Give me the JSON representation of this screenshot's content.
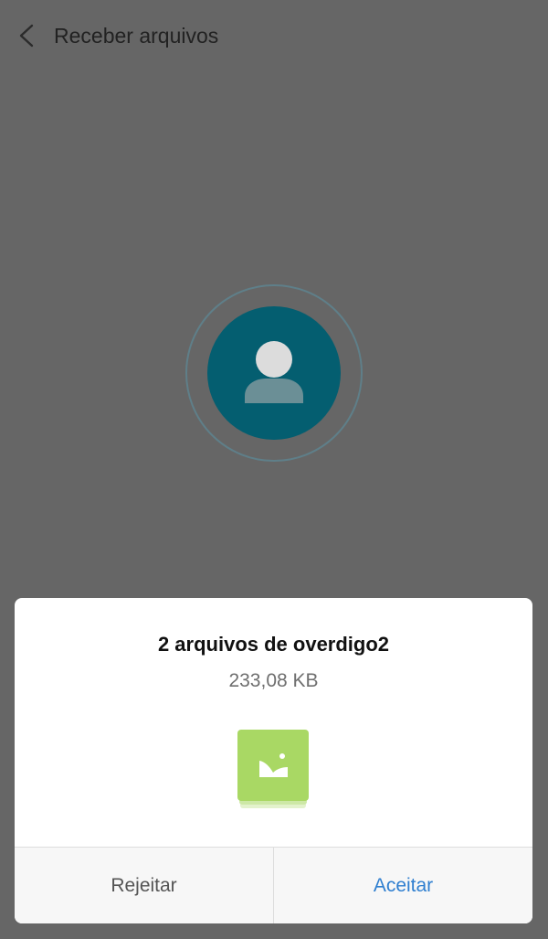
{
  "header": {
    "title": "Receber arquivos",
    "back_icon": "chevron-left-icon"
  },
  "sender": {
    "avatar_icon": "person-icon",
    "avatar_color": "#045e70"
  },
  "dialog": {
    "title": "2 arquivos de overdigo2",
    "size": "233,08 KB",
    "file_icon": "image-stack-icon",
    "file_icon_color": "#a9d864",
    "reject_label": "Rejeitar",
    "accept_label": "Aceitar",
    "accept_color": "#2f7fd0"
  }
}
